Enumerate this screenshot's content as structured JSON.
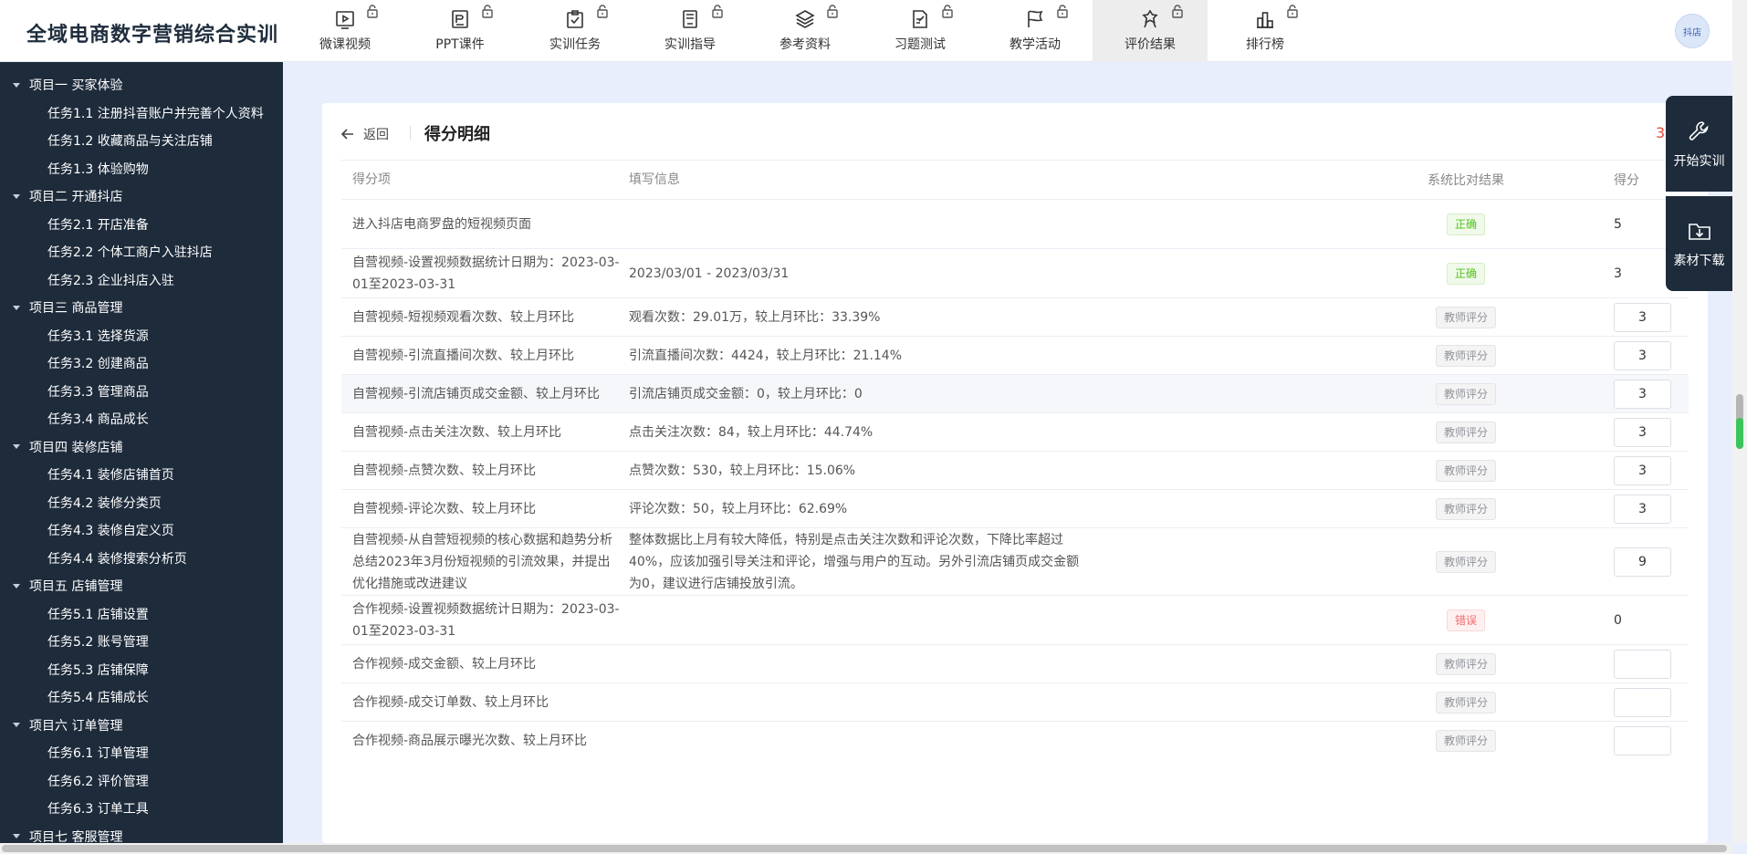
{
  "app": {
    "title": "全域电商数字营销综合实训",
    "avatar_text": "抖店"
  },
  "nav": [
    {
      "label": "微课视频",
      "icon": "video-icon"
    },
    {
      "label": "PPT课件",
      "icon": "ppt-icon"
    },
    {
      "label": "实训任务",
      "icon": "clipboard-check-icon"
    },
    {
      "label": "实训指导",
      "icon": "book-icon"
    },
    {
      "label": "参考资料",
      "icon": "layers-icon"
    },
    {
      "label": "习题测试",
      "icon": "edit-doc-icon"
    },
    {
      "label": "教学活动",
      "icon": "flag-icon"
    },
    {
      "label": "评价结果",
      "icon": "award-icon",
      "active": true
    },
    {
      "label": "排行榜",
      "icon": "bar-rank-icon"
    }
  ],
  "sidebar": {
    "projects": [
      {
        "label": "项目一 买家体验",
        "tasks": [
          "任务1.1 注册抖音账户并完善个人资料",
          "任务1.2 收藏商品与关注店铺",
          "任务1.3 体验购物"
        ]
      },
      {
        "label": "项目二 开通抖店",
        "tasks": [
          "任务2.1 开店准备",
          "任务2.2 个体工商户入驻抖店",
          "任务2.3 企业抖店入驻"
        ]
      },
      {
        "label": "项目三 商品管理",
        "tasks": [
          "任务3.1 选择货源",
          "任务3.2 创建商品",
          "任务3.3 管理商品",
          "任务3.4 商品成长"
        ]
      },
      {
        "label": "项目四 装修店铺",
        "tasks": [
          "任务4.1 装修店铺首页",
          "任务4.2 装修分类页",
          "任务4.3 装修自定义页",
          "任务4.4 装修搜索分析页"
        ]
      },
      {
        "label": "项目五 店铺管理",
        "tasks": [
          "任务5.1 店铺设置",
          "任务5.2 账号管理",
          "任务5.3 店铺保障",
          "任务5.4 店铺成长"
        ]
      },
      {
        "label": "项目六 订单管理",
        "tasks": [
          "任务6.1 订单管理",
          "任务6.2 评价管理",
          "任务6.3 订单工具"
        ]
      },
      {
        "label": "项目七 客服管理",
        "tasks": []
      }
    ]
  },
  "detail": {
    "back_label": "返回",
    "title": "得分明细",
    "corner_number": "3",
    "columns": {
      "item": "得分项",
      "info": "填写信息",
      "result": "系统比对结果",
      "score": "得分"
    },
    "rows": [
      {
        "item": "进入抖店电商罗盘的短视频页面",
        "info": "",
        "result": "正确",
        "status": "ok",
        "score": "5",
        "editable": false
      },
      {
        "item": "自营视频-设置视频数据统计日期为：2023-03-01至2023-03-31",
        "info": "2023/03/01 - 2023/03/31",
        "result": "正确",
        "status": "ok",
        "score": "3",
        "editable": false
      },
      {
        "item": "自营视频-短视频观看次数、较上月环比",
        "info": "观看次数：29.01万，较上月环比：33.39%",
        "result": "教师评分",
        "status": "tch",
        "score": "3",
        "editable": true
      },
      {
        "item": "自营视频-引流直播间次数、较上月环比",
        "info": "引流直播间次数：4424，较上月环比：21.14%",
        "result": "教师评分",
        "status": "tch",
        "score": "3",
        "editable": true
      },
      {
        "item": "自营视频-引流店铺页成交金额、较上月环比",
        "info": "引流店铺页成交金额：0，较上月环比：0",
        "result": "教师评分",
        "status": "tch",
        "score": "3",
        "editable": true,
        "highlight": true
      },
      {
        "item": "自营视频-点击关注次数、较上月环比",
        "info": "点击关注次数：84，较上月环比：44.74%",
        "result": "教师评分",
        "status": "tch",
        "score": "3",
        "editable": true
      },
      {
        "item": "自营视频-点赞次数、较上月环比",
        "info": "点赞次数：530，较上月环比：15.06%",
        "result": "教师评分",
        "status": "tch",
        "score": "3",
        "editable": true
      },
      {
        "item": "自营视频-评论次数、较上月环比",
        "info": "评论次数：50，较上月环比：62.69%",
        "result": "教师评分",
        "status": "tch",
        "score": "3",
        "editable": true
      },
      {
        "item": "自营视频-从自营短视频的核心数据和趋势分析总结2023年3月份短视频的引流效果，并提出优化措施或改进建议",
        "info": "整体数据比上月有较大降低，特别是点击关注次数和评论次数，下降比率超过40%，应该加强引导关注和评论，增强与用户的互动。另外引流店铺页成交金额为0，建议进行店铺投放引流。",
        "result": "教师评分",
        "status": "tch",
        "score": "9",
        "editable": true
      },
      {
        "item": "合作视频-设置视频数据统计日期为：2023-03-01至2023-03-31",
        "info": "",
        "result": "错误",
        "status": "err",
        "score": "0",
        "editable": false
      },
      {
        "item": "合作视频-成交金额、较上月环比",
        "info": "",
        "result": "教师评分",
        "status": "tch",
        "score": "",
        "editable": true
      },
      {
        "item": "合作视频-成交订单数、较上月环比",
        "info": "",
        "result": "教师评分",
        "status": "tch",
        "score": "",
        "editable": true
      },
      {
        "item": "合作视频-商品展示曝光次数、较上月环比",
        "info": "",
        "result": "教师评分",
        "status": "tch",
        "score": "",
        "editable": true
      }
    ]
  },
  "float_panel": {
    "start_label": "开始实训",
    "download_label": "素材下载"
  }
}
